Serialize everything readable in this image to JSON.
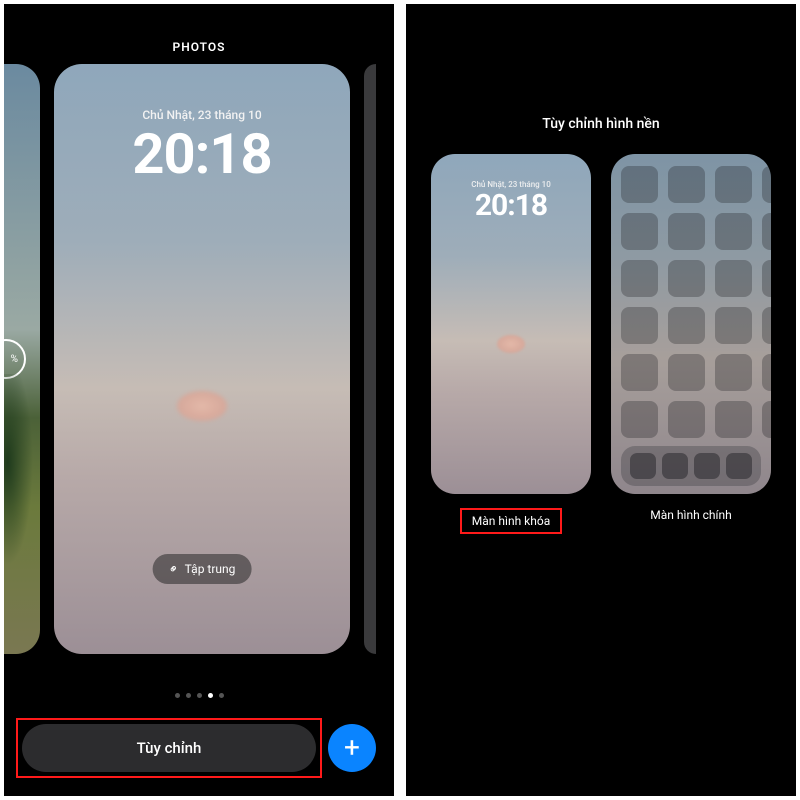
{
  "left": {
    "header": "PHOTOS",
    "lock": {
      "date": "Chủ Nhật, 23 tháng 10",
      "time": "20:18"
    },
    "focus_label": "Tập trung",
    "customize_label": "Tùy chỉnh",
    "add_label": "+",
    "page_count": 5,
    "page_active_index": 3,
    "peek_left_pct": "%"
  },
  "right": {
    "title": "Tùy chỉnh hình nền",
    "lock": {
      "date": "Chủ Nhật, 23 tháng 10",
      "time": "20:18"
    },
    "caption_lock": "Màn hình khóa",
    "caption_home": "Màn hình chính",
    "home_app_count": 24,
    "dock_app_count": 4
  },
  "colors": {
    "accent_blue": "#0a84ff",
    "highlight_red": "#ff1a1a"
  }
}
